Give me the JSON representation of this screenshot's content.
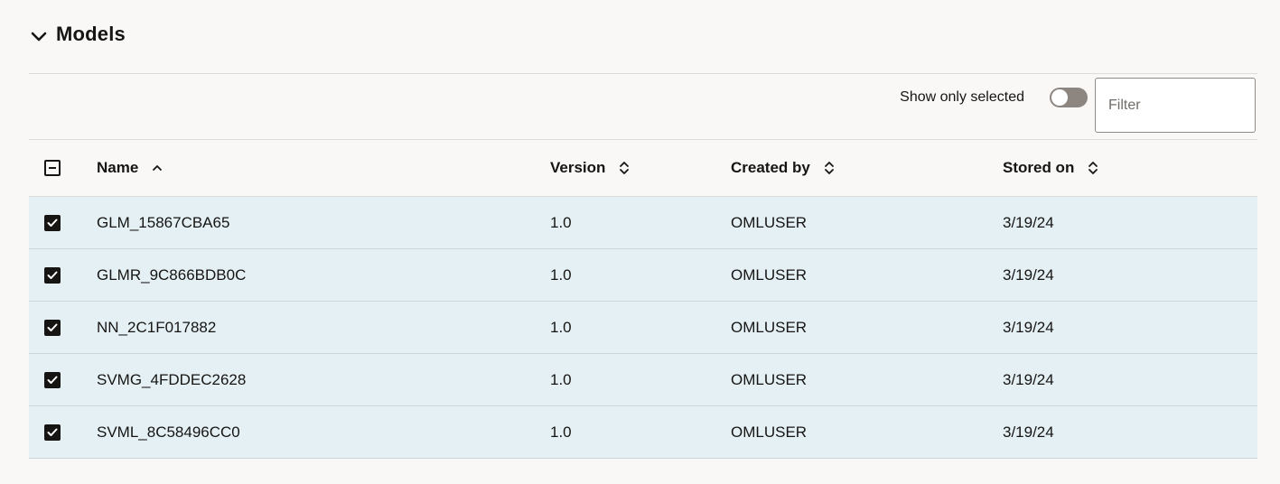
{
  "section": {
    "title": "Models"
  },
  "toolbar": {
    "show_only_selected_label": "Show only selected",
    "show_only_selected_on": false,
    "filter_placeholder": "Filter",
    "filter_value": ""
  },
  "table": {
    "columns": {
      "name": "Name",
      "version": "Version",
      "created_by": "Created by",
      "stored_on": "Stored on"
    },
    "sort": {
      "column": "name",
      "direction": "ascending"
    },
    "select_all_state": "partial",
    "rows": [
      {
        "selected": true,
        "name": "GLM_15867CBA65",
        "version": "1.0",
        "created_by": "OMLUSER",
        "stored_on": "3/19/24"
      },
      {
        "selected": true,
        "name": "GLMR_9C866BDB0C",
        "version": "1.0",
        "created_by": "OMLUSER",
        "stored_on": "3/19/24"
      },
      {
        "selected": true,
        "name": "NN_2C1F017882",
        "version": "1.0",
        "created_by": "OMLUSER",
        "stored_on": "3/19/24"
      },
      {
        "selected": true,
        "name": "SVMG_4FDDEC2628",
        "version": "1.0",
        "created_by": "OMLUSER",
        "stored_on": "3/19/24"
      },
      {
        "selected": true,
        "name": "SVML_8C58496CC0",
        "version": "1.0",
        "created_by": "OMLUSER",
        "stored_on": "3/19/24"
      }
    ]
  },
  "colors": {
    "background": "#f9f8f6",
    "selected_row": "#e4f0f4",
    "text": "#161513",
    "toggle_off": "#8c8580"
  },
  "icons": {
    "collapse": "chevron-down-icon",
    "sort_active": "chevron-up-icon",
    "sort_inactive": "sort-up-down-icon",
    "checked": "checkbox-checked-icon",
    "partial": "checkbox-partial-icon"
  }
}
